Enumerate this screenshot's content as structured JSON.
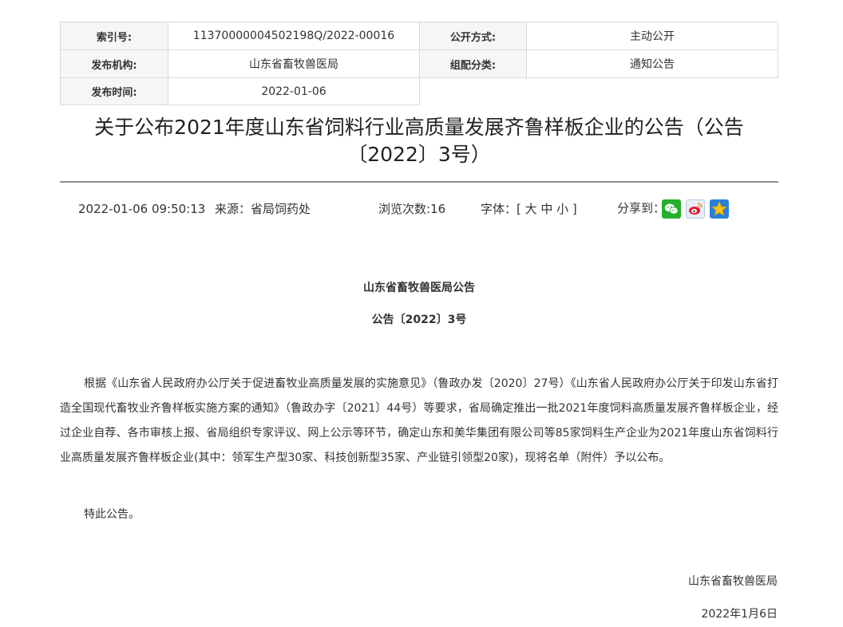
{
  "meta": {
    "index_label": "索引号:",
    "index_value": "11370000004502198Q/2022-00016",
    "open_label": "公开方式:",
    "open_value": "主动公开",
    "org_label": "发布机构:",
    "org_value": "山东省畜牧兽医局",
    "category_label": "组配分类:",
    "category_value": "通知公告",
    "date_label": "发布时间:",
    "date_value": "2022-01-06"
  },
  "article": {
    "title_line1": "关于公布2021年度山东省饲料行业高质量发展齐鲁样板企业的公告（公告",
    "title_line2": "〔2022〕3号）"
  },
  "info": {
    "datetime": "2022-01-06 09:50:13",
    "source": "来源：省局饲药处",
    "views": "浏览次数:16",
    "font_label": "字体：[ 大 中 小 ]",
    "share_label": "分享到："
  },
  "share_icons": [
    "wechat-icon",
    "weibo-icon",
    "qzone-icon"
  ],
  "colors": {
    "wechat": "#25b02c",
    "weibo": "#e6162d",
    "qzone": "#2a7fd8",
    "rule": "#8f8f8f"
  },
  "body": {
    "heading": "山东省畜牧兽医局公告",
    "number": "公告〔2022〕3号",
    "paragraph1": "根据《山东省人民政府办公厅关于促进畜牧业高质量发展的实施意见》（鲁政办发〔2020〕27号）《山东省人民政府办公厅关于印发山东省打造全国现代畜牧业齐鲁样板实施方案的通知》（鲁政办字〔2021〕44号）等要求，省局确定推出一批2021年度饲料高质量发展齐鲁样板企业，经过企业自荐、各市审核上报、省局组织专家评议、网上公示等环节，确定山东和美华集团有限公司等85家饲料生产企业为2021年度山东省饲料行业高质量发展齐鲁样板企业(其中：领军生产型30家、科技创新型35家、产业链引领型20家)，现将名单（附件）予以公布。",
    "paragraph2": "特此公告。",
    "sign_org": "山东省畜牧兽医局",
    "sign_date": "2022年1月6日"
  }
}
